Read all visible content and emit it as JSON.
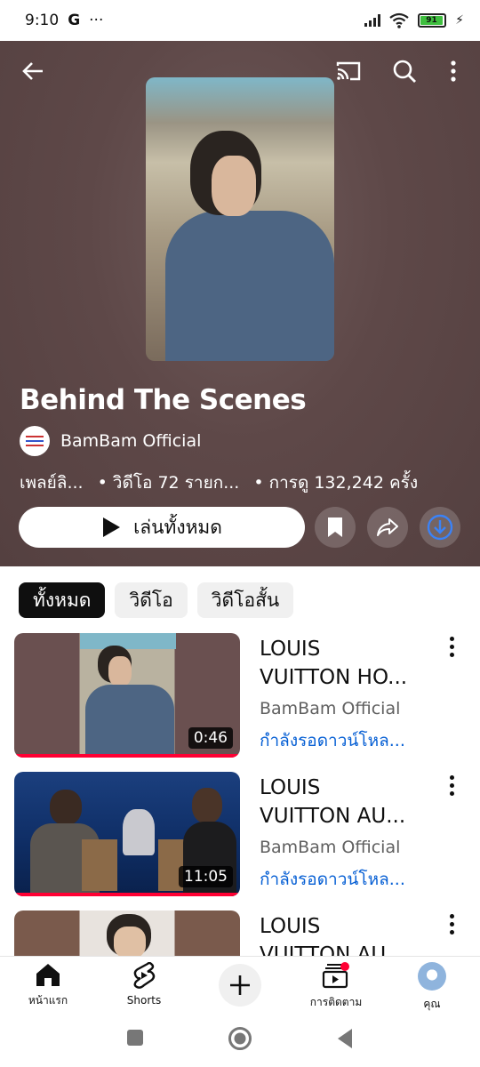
{
  "status_bar": {
    "time": "9:10",
    "g_icon": "G",
    "more": "···",
    "battery": "91"
  },
  "header": {
    "title": "Behind The Scenes",
    "channel": "BamBam Official",
    "meta": [
      "เพลย์ลิ...",
      "• วิดีโอ 72 รายก...",
      "• การดู 132,242 ครั้ง"
    ],
    "play_all": "เล่นทั้งหมด"
  },
  "chips": [
    "ทั้งหมด",
    "วิดีโอ",
    "วิดีโอสั้น"
  ],
  "videos": [
    {
      "title_line1": "LOUIS",
      "title_line2": "VUITTON HO...",
      "channel": "BamBam Official",
      "status": "กำลังรอดาวน์โหล...",
      "duration": "0:46"
    },
    {
      "title_line1": "LOUIS",
      "title_line2": "VUITTON AU...",
      "channel": "BamBam Official",
      "status": "กำลังรอดาวน์โหล...",
      "duration": "11:05"
    },
    {
      "title_line1": "LOUIS",
      "title_line2": "VUITTON AU..."
    }
  ],
  "nav": {
    "home": "หน้าแรก",
    "shorts": "Shorts",
    "subscriptions": "การติดตาม",
    "you": "คุณ"
  },
  "colors": {
    "header_bg": "#5e4848",
    "accent_red": "#ff0033",
    "link_blue": "#065fd4"
  }
}
